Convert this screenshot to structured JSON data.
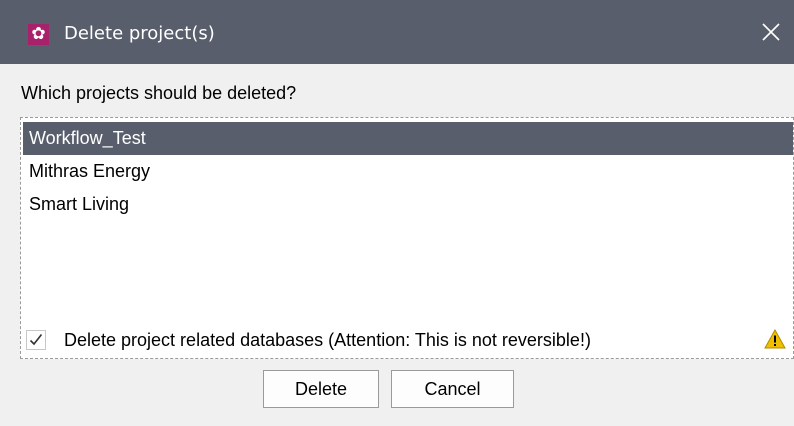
{
  "dialog": {
    "title": "Delete project(s)",
    "app_icon": "gear-icon",
    "close_icon": "close-icon"
  },
  "prompt": "Which projects should be deleted?",
  "projects": [
    {
      "label": "Workflow_Test",
      "selected": true
    },
    {
      "label": "Mithras Energy",
      "selected": false
    },
    {
      "label": "Smart Living",
      "selected": false
    }
  ],
  "option": {
    "label": "Delete project related databases (Attention: This is not reversible!)",
    "checked": true,
    "warning_icon": "warning-icon"
  },
  "buttons": {
    "delete_label": "Delete",
    "cancel_label": "Cancel"
  },
  "colors": {
    "title_bar": "#595e6d",
    "app_icon_bg": "#a8226b",
    "selection": "#595e6d",
    "warning": "#f0c000"
  }
}
